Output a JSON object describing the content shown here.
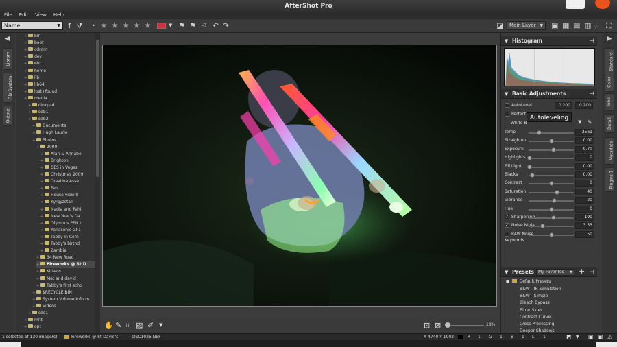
{
  "window": {
    "title": "AfterShot Pro"
  },
  "menu": [
    "File",
    "Edit",
    "View",
    "Help"
  ],
  "toolbar": {
    "sort_value": "Name",
    "layer_value": "Main Layer",
    "colors": {
      "label_chip": "#c8343f"
    }
  },
  "left_tabs": [
    "Library",
    "File System",
    "Output"
  ],
  "tree": [
    {
      "label": "bin",
      "indent": 1
    },
    {
      "label": "boot",
      "indent": 1
    },
    {
      "label": "cdrom",
      "indent": 1
    },
    {
      "label": "dev",
      "indent": 1
    },
    {
      "label": "etc",
      "indent": 1
    },
    {
      "label": "home",
      "indent": 1
    },
    {
      "label": "lib",
      "indent": 1
    },
    {
      "label": "lib64",
      "indent": 1
    },
    {
      "label": "lost+found",
      "indent": 1
    },
    {
      "label": "media",
      "indent": 1
    },
    {
      "label": "cinkpad",
      "indent": 2
    },
    {
      "label": "sdb1",
      "indent": 2
    },
    {
      "label": "sdb2",
      "indent": 2
    },
    {
      "label": "Documents",
      "indent": 3
    },
    {
      "label": "Hugh Laurie",
      "indent": 3
    },
    {
      "label": "Photos",
      "indent": 3
    },
    {
      "label": "2009",
      "indent": 4
    },
    {
      "label": "Alan & Annabe",
      "indent": 5
    },
    {
      "label": "Brighton",
      "indent": 5
    },
    {
      "label": "CES in Vegas",
      "indent": 5
    },
    {
      "label": "Christmas 2009",
      "indent": 5
    },
    {
      "label": "Creative Asse",
      "indent": 5
    },
    {
      "label": "Feb",
      "indent": 5
    },
    {
      "label": "House view II",
      "indent": 5
    },
    {
      "label": "Kyrgyzstan",
      "indent": 5
    },
    {
      "label": "Nadia and Fahi",
      "indent": 5
    },
    {
      "label": "New Year's Da",
      "indent": 5
    },
    {
      "label": "Olympus PEN t",
      "indent": 5
    },
    {
      "label": "Panasonic GF1",
      "indent": 5
    },
    {
      "label": "Tabby in Corn",
      "indent": 5
    },
    {
      "label": "Tabby's birthd",
      "indent": 5
    },
    {
      "label": "Zambia",
      "indent": 5
    },
    {
      "label": "34 New Road",
      "indent": 4
    },
    {
      "label": "Fireworks @ St D",
      "indent": 4,
      "selected": true
    },
    {
      "label": "Kittens",
      "indent": 4
    },
    {
      "label": "Mat and david",
      "indent": 4
    },
    {
      "label": "Tabby's first scho",
      "indent": 4
    },
    {
      "label": "$RECYCLE.BIN",
      "indent": 3
    },
    {
      "label": "System Volume Inform",
      "indent": 3
    },
    {
      "label": "Videos",
      "indent": 3
    },
    {
      "label": "sdc1",
      "indent": 2
    },
    {
      "label": "mnt",
      "indent": 1
    },
    {
      "label": "opt",
      "indent": 1
    }
  ],
  "right_panel": {
    "histogram_title": "Histogram",
    "basic_title": "Basic Adjustments",
    "autolevel": {
      "label": "AutoLevel",
      "low": "0.200",
      "high": "0.200"
    },
    "perfect_label": "Perfect",
    "white_balance_label": "White B",
    "tooltip": "Autoleveling",
    "sliders": [
      {
        "label": "Temp",
        "value": "3561",
        "pos": 0.22
      },
      {
        "label": "Straighten",
        "value": "0.00",
        "pos": 0.5
      },
      {
        "label": "Exposure",
        "value": "0.70",
        "pos": 0.55
      },
      {
        "label": "Highlights",
        "value": "0",
        "pos": 0.02
      },
      {
        "label": "Fill Light",
        "value": "0.00",
        "pos": 0.02
      },
      {
        "label": "Blacks",
        "value": "0.00",
        "pos": 0.08
      },
      {
        "label": "Contrast",
        "value": "0",
        "pos": 0.5
      },
      {
        "label": "Saturation",
        "value": "40",
        "pos": 0.62
      },
      {
        "label": "Vibrance",
        "value": "20",
        "pos": 0.56
      },
      {
        "label": "Hue",
        "value": "0",
        "pos": 0.5
      },
      {
        "label": "Sharpening",
        "value": "190",
        "pos": 0.55,
        "checked": true
      },
      {
        "label": "Noise Ninja",
        "value": "3.53",
        "pos": 0.3,
        "checked": true
      },
      {
        "label": "RAW Noise",
        "value": "50",
        "pos": 0.5,
        "checked": false
      }
    ],
    "keywords_label": "Keywords",
    "presets_title": "Presets",
    "presets_selector": "My Favorites",
    "presets_folder": "Default Presets",
    "presets": [
      "B&W - IR Simulation",
      "B&W - Simple",
      "Bleach Bypass",
      "Bluer Skies",
      "Contrast Curve",
      "Cross Processing",
      "Deeper Shadows"
    ]
  },
  "right_tabs": [
    "Standard",
    "Color",
    "Tone",
    "Detail",
    "Metadata",
    "Plugins 1"
  ],
  "viewer": {
    "zoom": "18%"
  },
  "status": {
    "selection": "1 selected of 130 image(s)",
    "folder": "Fireworks @ St David's",
    "file": "_DSC1025.NEF",
    "dims": "X 4740  Y 1902",
    "r_label": "R",
    "r_val": "1",
    "g_label": "G",
    "g_val": "1",
    "b_label": "B",
    "b_val": "1",
    "l_label": "L",
    "l_val": "1"
  }
}
